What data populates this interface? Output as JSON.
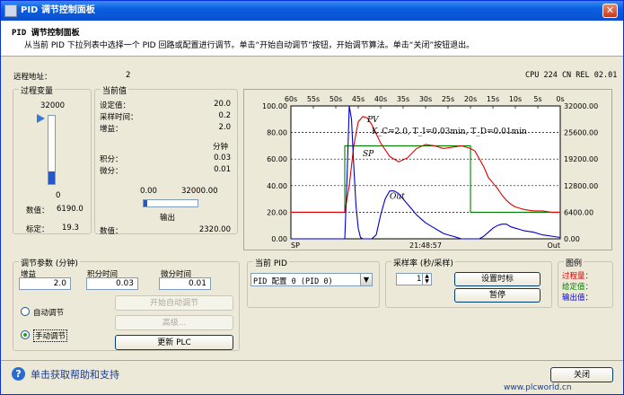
{
  "window": {
    "title": "PID 调节控制面板",
    "close_glyph": "✕"
  },
  "header": {
    "title": "PID 调节控制面板",
    "description": "从当前 PID 下拉列表中选择一个 PID 回路或配置进行调节。单击“开始自动调节”按钮，开始调节算法。单击“关闭”按钮退出。"
  },
  "status": {
    "remote_label": "远程地址：",
    "remote_value": "2",
    "cpu": "CPU 224 CN REL 02.01"
  },
  "process_variable": {
    "group_label": "过程变量",
    "top_value": "32000",
    "bottom_value": "0",
    "value_label": "数值：",
    "value": "6190.0",
    "scale_label": "标定：",
    "scale": "19.3",
    "level_fraction": 0.19
  },
  "current_values": {
    "group_label": "当前值",
    "rows": [
      {
        "label": "设定值：",
        "value": "20.0"
      },
      {
        "label": "采样时间：",
        "value": "0.2"
      },
      {
        "label": "增益：",
        "value": "2.0"
      }
    ],
    "minute_label": "分钟",
    "rows2": [
      {
        "label": "积分：",
        "value": "0.03"
      },
      {
        "label": "微分：",
        "value": "0.01"
      }
    ],
    "output_min": "0.00",
    "output_max": "32000.00",
    "output_label": "输出",
    "output_value_label": "数值：",
    "output_value": "2320.00",
    "output_fraction": 0.07
  },
  "chart_data": {
    "type": "line",
    "x_ticks": [
      "60s",
      "55s",
      "50s",
      "45s",
      "40s",
      "35s",
      "30s",
      "25s",
      "20s",
      "15s",
      "10s",
      "5s",
      "0s"
    ],
    "y_left_ticks": [
      "100.00",
      "80.00",
      "60.00",
      "40.00",
      "20.00",
      "0.00"
    ],
    "y_right_ticks": [
      "32000.00",
      "25600.00",
      "19200.00",
      "12800.00",
      "6400.00",
      "0.00"
    ],
    "ylim": [
      0,
      100
    ],
    "bottom_left": "SP",
    "bottom_center": "21:48:57",
    "bottom_right": "Out",
    "annotation": "K_C=2.0, T_I=0.03min, T_D=0.01min",
    "series": [
      {
        "name": "SP",
        "color": "#008000",
        "x": [
          60,
          48,
          48,
          20,
          20,
          0
        ],
        "y": [
          20,
          20,
          70,
          70,
          20,
          20
        ]
      },
      {
        "name": "PV",
        "color": "#e00000",
        "x": [
          60,
          48,
          47,
          46,
          45,
          44,
          43,
          42,
          41,
          40,
          39,
          38,
          36,
          34,
          32,
          30,
          28,
          26,
          24,
          22,
          21,
          20,
          19,
          18,
          17,
          16,
          15,
          14,
          13,
          12,
          11,
          10,
          9,
          8,
          6,
          4,
          2,
          0
        ],
        "y": [
          20,
          20,
          40,
          70,
          88,
          92,
          91,
          86,
          79,
          72,
          67,
          62,
          58,
          61,
          68,
          71,
          70,
          68,
          69,
          70,
          69,
          68,
          66,
          60,
          54,
          46,
          42,
          38,
          33,
          29,
          26,
          24,
          23,
          22,
          21,
          21,
          20,
          20
        ]
      },
      {
        "name": "Out",
        "color": "#0000cc",
        "x": [
          60,
          48,
          47.5,
          47,
          46.5,
          46,
          45.5,
          45,
          44.5,
          44,
          43,
          42,
          41,
          40,
          39,
          38,
          37,
          36,
          35,
          34,
          33,
          32,
          31,
          30,
          29,
          28,
          27,
          26,
          25,
          24,
          23,
          22,
          21,
          20,
          19.5,
          19,
          18.5,
          18,
          17,
          16,
          15,
          14,
          13,
          12,
          11,
          10,
          9,
          8,
          6,
          4,
          2,
          0
        ],
        "y": [
          0,
          0,
          45,
          100,
          90,
          55,
          25,
          8,
          1,
          0,
          0,
          0,
          3,
          18,
          30,
          36,
          36,
          34,
          30,
          26,
          22,
          18,
          15,
          12,
          10,
          8,
          6,
          4,
          3,
          2,
          1,
          0,
          0,
          0,
          0,
          0,
          0,
          0,
          2,
          5,
          8,
          10,
          11,
          11,
          9,
          8,
          7,
          6,
          5,
          3,
          2,
          1
        ]
      }
    ],
    "legend_title": "图例",
    "legend": [
      {
        "label": "过程量：",
        "color": "#e00000"
      },
      {
        "label": "给定值：",
        "color": "#008000"
      },
      {
        "label": "输出值：",
        "color": "#0000cc"
      }
    ]
  },
  "tuning": {
    "group_label": "调节参数 (分钟)",
    "gain_label": "增益",
    "gain_value": "2.0",
    "integral_label": "积分时间",
    "integral_value": "0.03",
    "derivative_label": "微分时间",
    "derivative_value": "0.01",
    "auto_label": "自动调节",
    "manual_label": "手动调节",
    "start_auto_button": "开始自动调节",
    "advanced_button": "高级...",
    "update_button": "更新 PLC"
  },
  "current_pid": {
    "group_label": "当前 PID",
    "selected": "PID 配置 0 (PID 0)"
  },
  "sample_rate": {
    "group_label": "采样率 (秒/采样)",
    "value": "1",
    "set_time_button": "设置时标",
    "pause_button": "暂停"
  },
  "footer": {
    "help_text": "单击获取帮助和支持",
    "close_button": "关闭",
    "watermark": "www.plcworld.cn"
  }
}
